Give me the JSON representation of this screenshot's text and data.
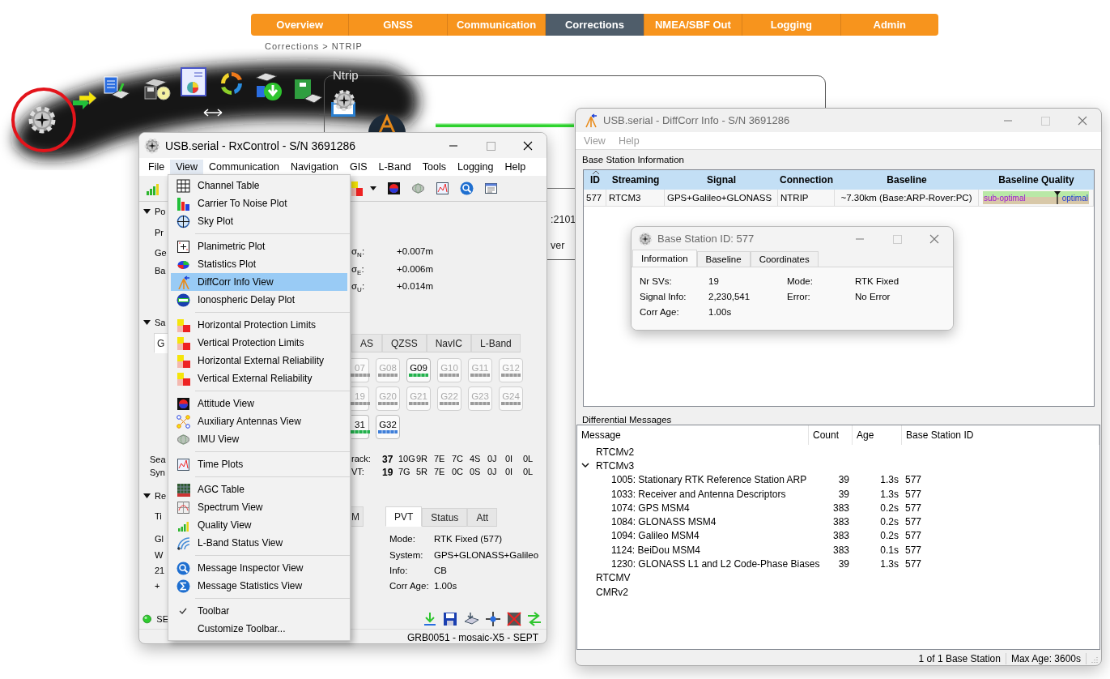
{
  "web_nav": {
    "tabs": [
      {
        "label": "Overview",
        "selected": false
      },
      {
        "label": "GNSS",
        "selected": false
      },
      {
        "label": "Communication",
        "selected": false
      },
      {
        "label": "Corrections",
        "selected": true
      },
      {
        "label": "NMEA/SBF Out",
        "selected": false
      },
      {
        "label": "Logging",
        "selected": false
      },
      {
        "label": "Admin",
        "selected": false
      }
    ]
  },
  "breadcrumb": "Corrections > NTRIP",
  "ntrip_panel": {
    "legend": "Ntrip",
    "texts": [
      ":2101",
      "ver"
    ]
  },
  "rx_control": {
    "title": "USB.serial - RxControl - S/N 3691286",
    "menu": [
      {
        "label": "File",
        "selected": false
      },
      {
        "label": "View",
        "selected": true
      },
      {
        "label": "Communication",
        "selected": false
      },
      {
        "label": "Navigation",
        "selected": false
      },
      {
        "label": "GIS",
        "selected": false
      },
      {
        "label": "L-Band",
        "selected": false
      },
      {
        "label": "Tools",
        "selected": false
      },
      {
        "label": "Logging",
        "selected": false
      },
      {
        "label": "Help",
        "selected": false
      }
    ],
    "position_section": {
      "heading": "Po",
      "expanded": true,
      "labels": [
        "Pr",
        "Ge",
        "Ba"
      ],
      "sigmas": [
        {
          "label": "σ$_{N}$:",
          "value": "+0.007m"
        },
        {
          "label": "σ$_{E}$:",
          "value": "+0.006m"
        },
        {
          "label": "σ$_{U}$:",
          "value": "+0.014m"
        }
      ]
    },
    "satellite_section": {
      "heading": "Sa",
      "expanded": true,
      "tabs": [
        {
          "label": "G",
          "selected": true
        },
        {
          "label": "AS",
          "selected": false
        },
        {
          "label": "QZSS",
          "selected": false
        },
        {
          "label": "NavIC",
          "selected": false
        },
        {
          "label": "L-Band",
          "selected": false
        }
      ],
      "satellites": [
        {
          "label": "07",
          "active": false
        },
        {
          "label": "G08",
          "active": false
        },
        {
          "label": "G09",
          "active": true,
          "color": "#22b14c"
        },
        {
          "label": "G10",
          "active": false
        },
        {
          "label": "G11",
          "active": false
        },
        {
          "label": "G12",
          "active": false
        },
        {
          "label": "19",
          "active": false
        },
        {
          "label": "G20",
          "active": false
        },
        {
          "label": "G21",
          "active": false
        },
        {
          "label": "G22",
          "active": false
        },
        {
          "label": "G23",
          "active": false
        },
        {
          "label": "G24",
          "active": false
        },
        {
          "label": "31",
          "active": true,
          "color": "#22b14c"
        },
        {
          "label": "G32",
          "active": true,
          "color": "#3f7fd9"
        }
      ],
      "labels": [
        "Sea",
        "Syn"
      ],
      "track": {
        "label": "rack:",
        "total": "37",
        "counts": [
          "10G",
          "9R",
          "7E",
          "7C",
          "4S",
          "0J",
          "0I",
          "0L"
        ]
      },
      "pvt": {
        "label": "VT:",
        "total": "19",
        "counts": [
          "7G",
          "5R",
          "7E",
          "0C",
          "0S",
          "0J",
          "0I",
          "0L"
        ]
      }
    },
    "receiver_section": {
      "heading": "Re",
      "expanded": true,
      "labels": [
        "Ti",
        "Gl",
        "W",
        "21",
        "+"
      ],
      "tab_fragment": "M",
      "tabs": [
        {
          "label": "PVT",
          "selected": true
        },
        {
          "label": "Status",
          "selected": false
        },
        {
          "label": "Att",
          "selected": false
        }
      ],
      "fields": [
        {
          "label": "Mode:",
          "value": "RTK Fixed (577)"
        },
        {
          "label": "System:",
          "value": "GPS+GLONASS+Galileo"
        },
        {
          "label": "Info:",
          "value": "CB"
        },
        {
          "label": "Corr Age:",
          "value": "1.00s"
        }
      ]
    },
    "status_led": {
      "on": true,
      "label": "SE"
    },
    "status_bar": "GRB0051 - mosaic-X5 - SEPT"
  },
  "view_menu": {
    "items": [
      {
        "kind": "item",
        "label": "Channel Table",
        "selected": false,
        "checked": false
      },
      {
        "kind": "item",
        "label": "Carrier To Noise Plot",
        "selected": false,
        "checked": false
      },
      {
        "kind": "item",
        "label": "Sky Plot",
        "selected": false,
        "checked": false
      },
      {
        "kind": "separator"
      },
      {
        "kind": "item",
        "label": "Planimetric Plot",
        "selected": false,
        "checked": false
      },
      {
        "kind": "item",
        "label": "Statistics Plot",
        "selected": false,
        "checked": false
      },
      {
        "kind": "item",
        "label": "DiffCorr Info View",
        "selected": true,
        "checked": false
      },
      {
        "kind": "item",
        "label": "Ionospheric Delay Plot",
        "selected": false,
        "checked": false
      },
      {
        "kind": "separator"
      },
      {
        "kind": "item",
        "label": "Horizontal Protection Limits",
        "selected": false,
        "checked": false
      },
      {
        "kind": "item",
        "label": "Vertical Protection Limits",
        "selected": false,
        "checked": false
      },
      {
        "kind": "item",
        "label": "Horizontal External Reliability",
        "selected": false,
        "checked": false
      },
      {
        "kind": "item",
        "label": "Vertical External Reliability",
        "selected": false,
        "checked": false
      },
      {
        "kind": "separator"
      },
      {
        "kind": "item",
        "label": "Attitude View",
        "selected": false,
        "checked": false
      },
      {
        "kind": "item",
        "label": "Auxiliary Antennas View",
        "selected": false,
        "checked": false
      },
      {
        "kind": "item",
        "label": "IMU View",
        "selected": false,
        "checked": false
      },
      {
        "kind": "separator"
      },
      {
        "kind": "item",
        "label": "Time Plots",
        "selected": false,
        "checked": false
      },
      {
        "kind": "separator"
      },
      {
        "kind": "item",
        "label": "AGC Table",
        "selected": false,
        "checked": false
      },
      {
        "kind": "item",
        "label": "Spectrum View",
        "selected": false,
        "checked": false
      },
      {
        "kind": "item",
        "label": "Quality View",
        "selected": false,
        "checked": false
      },
      {
        "kind": "item",
        "label": "L-Band Status View",
        "selected": false,
        "checked": false
      },
      {
        "kind": "separator"
      },
      {
        "kind": "item",
        "label": "Message Inspector View",
        "selected": false,
        "checked": false
      },
      {
        "kind": "item",
        "label": "Message Statistics View",
        "selected": false,
        "checked": false
      },
      {
        "kind": "separator"
      },
      {
        "kind": "item",
        "label": "Toolbar",
        "selected": false,
        "checked": true
      },
      {
        "kind": "item",
        "label": "Customize Toolbar...",
        "selected": false,
        "checked": false
      }
    ]
  },
  "diffcorr": {
    "title": "USB.serial - DiffCorr Info - S/N 3691286",
    "menu": [
      "View",
      "Help"
    ],
    "base_group": "Base Station Information",
    "base_table": {
      "columns": [
        "ID",
        "Streaming",
        "Signal",
        "Connection",
        "Baseline",
        "Baseline Quality"
      ],
      "rows": [
        {
          "cells": [
            "577",
            "RTCM3",
            "GPS+Galileo+GLONASS",
            "NTRIP",
            "~7.30km (Base:ARP-Rover:PC)"
          ],
          "quality": {
            "low_label": "sub-optimal",
            "high_label": "optimal",
            "level": 0.7
          }
        }
      ]
    },
    "messages_group": "Differential Messages",
    "messages_tree": {
      "columns": [
        "Message",
        "Count",
        "Age",
        "Base Station ID"
      ],
      "items": [
        {
          "message": "RTCMv2",
          "expanded": false
        },
        {
          "message": "RTCMv3",
          "expanded": true,
          "children": [
            {
              "message": "1005: Stationary RTK Reference Station ARP",
              "count": "39",
              "age": "1.3s",
              "base_id": "577"
            },
            {
              "message": "1033: Receiver and Antenna Descriptors",
              "count": "39",
              "age": "1.3s",
              "base_id": "577"
            },
            {
              "message": "1074: GPS MSM4",
              "count": "383",
              "age": "0.2s",
              "base_id": "577"
            },
            {
              "message": "1084: GLONASS MSM4",
              "count": "383",
              "age": "0.2s",
              "base_id": "577"
            },
            {
              "message": "1094: Galileo MSM4",
              "count": "383",
              "age": "0.2s",
              "base_id": "577"
            },
            {
              "message": "1124: BeiDou MSM4",
              "count": "383",
              "age": "0.1s",
              "base_id": "577"
            },
            {
              "message": "1230: GLONASS L1 and L2 Code-Phase Biases",
              "count": "39",
              "age": "1.3s",
              "base_id": "577"
            }
          ]
        },
        {
          "message": "RTCMV",
          "expanded": false
        },
        {
          "message": "CMRv2",
          "expanded": false
        }
      ]
    },
    "status": [
      "1 of 1 Base Station",
      "Max Age: 3600s"
    ]
  },
  "base_station_popup": {
    "title": "Base Station ID: 577",
    "tabs": [
      {
        "label": "Information",
        "selected": true
      },
      {
        "label": "Baseline",
        "selected": false
      },
      {
        "label": "Coordinates",
        "selected": false
      }
    ],
    "fields": [
      {
        "label": "Nr SVs:",
        "value": "19"
      },
      {
        "label": "Mode:",
        "value": "RTK Fixed"
      },
      {
        "label": "Signal Info:",
        "value": "2,230,541"
      },
      {
        "label": "Error:",
        "value": "No Error"
      },
      {
        "label": "Corr Age:",
        "value": "1.00s"
      }
    ]
  }
}
